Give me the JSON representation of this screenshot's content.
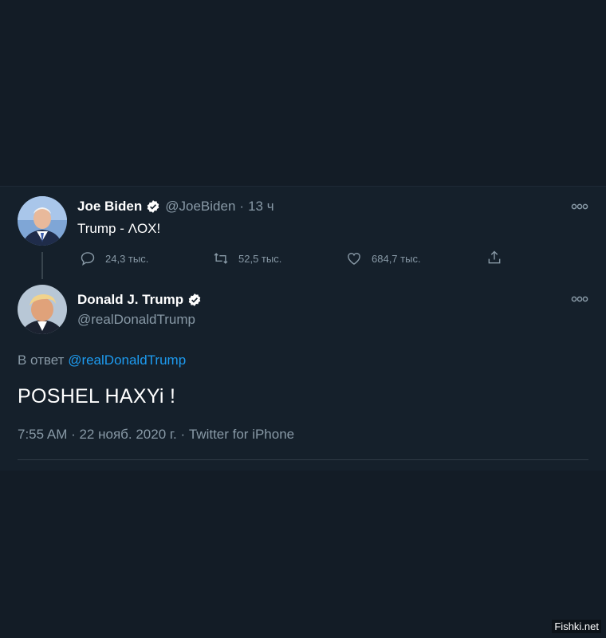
{
  "tweet1": {
    "name": "Joe Biden",
    "handle": "@JoeBiden",
    "separator": "·",
    "time": "13 ч",
    "text": "Trump - ΛOX!",
    "replies": "24,3 тыс.",
    "retweets": "52,5 тыс.",
    "likes": "684,7 тыс."
  },
  "tweet2": {
    "name": "Donald J. Trump",
    "handle": "@realDonaldTrump",
    "reply_prefix": "В ответ",
    "reply_to": "@realDonaldTrump",
    "text": "POSHEL HAXYi !",
    "timestamp": "7:55 AM · 22 нояб. 2020 г. · Twitter for iPhone"
  },
  "watermark": "Fishki.net",
  "colors": {
    "background": "#15202b",
    "secondary_text": "#8899a6",
    "link": "#1d9bf0",
    "verified": "#ffffff"
  },
  "icons": [
    "verified-badge-icon",
    "more-options-icon",
    "reply-icon",
    "retweet-icon",
    "like-icon",
    "share-icon"
  ]
}
